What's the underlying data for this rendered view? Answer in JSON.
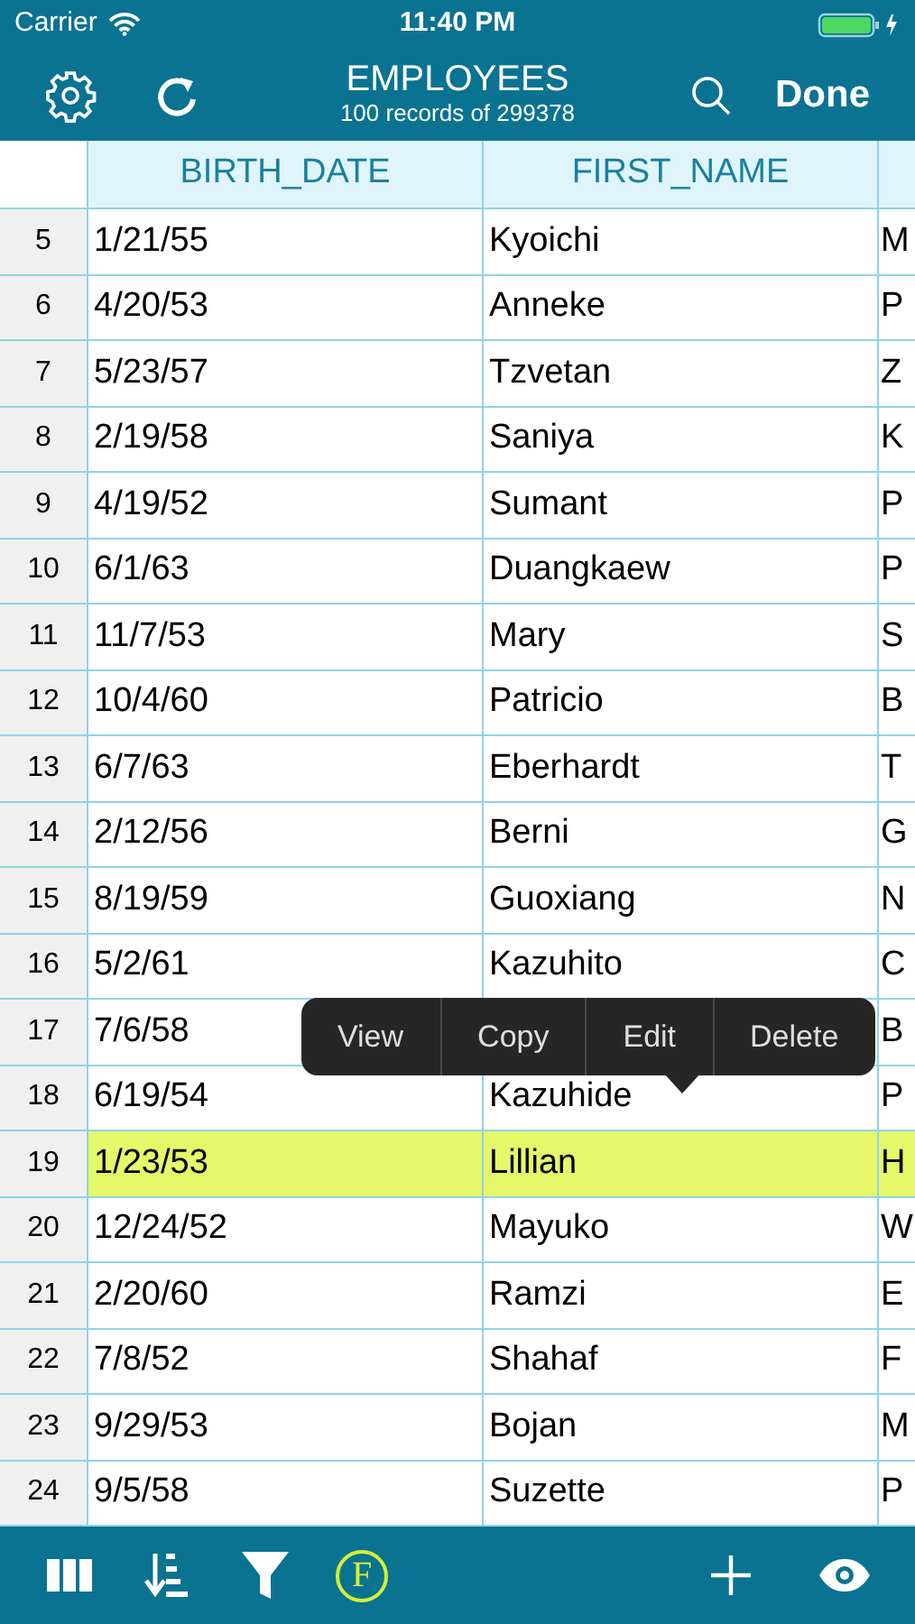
{
  "status_bar": {
    "carrier": "Carrier",
    "time": "11:40 PM"
  },
  "nav": {
    "title": "EMPLOYEES",
    "subtitle": "100 records of 299378",
    "done": "Done"
  },
  "table": {
    "columns": [
      "BIRTH_DATE",
      "FIRST_NAME"
    ],
    "rows": [
      {
        "number": "5",
        "cells": [
          "1/21/55",
          "Kyoichi",
          "M"
        ],
        "selected": false
      },
      {
        "number": "6",
        "cells": [
          "4/20/53",
          "Anneke",
          "P"
        ],
        "selected": false
      },
      {
        "number": "7",
        "cells": [
          "5/23/57",
          "Tzvetan",
          "Z"
        ],
        "selected": false
      },
      {
        "number": "8",
        "cells": [
          "2/19/58",
          "Saniya",
          "K"
        ],
        "selected": false
      },
      {
        "number": "9",
        "cells": [
          "4/19/52",
          "Sumant",
          "P"
        ],
        "selected": false
      },
      {
        "number": "10",
        "cells": [
          "6/1/63",
          "Duangkaew",
          "P"
        ],
        "selected": false
      },
      {
        "number": "11",
        "cells": [
          "11/7/53",
          "Mary",
          "S"
        ],
        "selected": false
      },
      {
        "number": "12",
        "cells": [
          "10/4/60",
          "Patricio",
          "B"
        ],
        "selected": false
      },
      {
        "number": "13",
        "cells": [
          "6/7/63",
          "Eberhardt",
          "T"
        ],
        "selected": false
      },
      {
        "number": "14",
        "cells": [
          "2/12/56",
          "Berni",
          "G"
        ],
        "selected": false
      },
      {
        "number": "15",
        "cells": [
          "8/19/59",
          "Guoxiang",
          "N"
        ],
        "selected": false
      },
      {
        "number": "16",
        "cells": [
          "5/2/61",
          "Kazuhito",
          "C"
        ],
        "selected": false
      },
      {
        "number": "17",
        "cells": [
          "7/6/58",
          null,
          "B"
        ],
        "selected": false
      },
      {
        "number": "18",
        "cells": [
          "6/19/54",
          "Kazuhide",
          "P"
        ],
        "selected": false
      },
      {
        "number": "19",
        "cells": [
          "1/23/53",
          "Lillian",
          "H"
        ],
        "selected": true
      },
      {
        "number": "20",
        "cells": [
          "12/24/52",
          "Mayuko",
          "W"
        ],
        "selected": false
      },
      {
        "number": "21",
        "cells": [
          "2/20/60",
          "Ramzi",
          "E"
        ],
        "selected": false
      },
      {
        "number": "22",
        "cells": [
          "7/8/52",
          "Shahaf",
          "F"
        ],
        "selected": false
      },
      {
        "number": "23",
        "cells": [
          "9/29/53",
          "Bojan",
          "M"
        ],
        "selected": false
      },
      {
        "number": "24",
        "cells": [
          "9/5/58",
          "Suzette",
          "P"
        ],
        "selected": false
      }
    ]
  },
  "context_menu": [
    "View",
    "Copy",
    "Edit",
    "Delete"
  ],
  "toolbar": {
    "formula_label": "F"
  }
}
